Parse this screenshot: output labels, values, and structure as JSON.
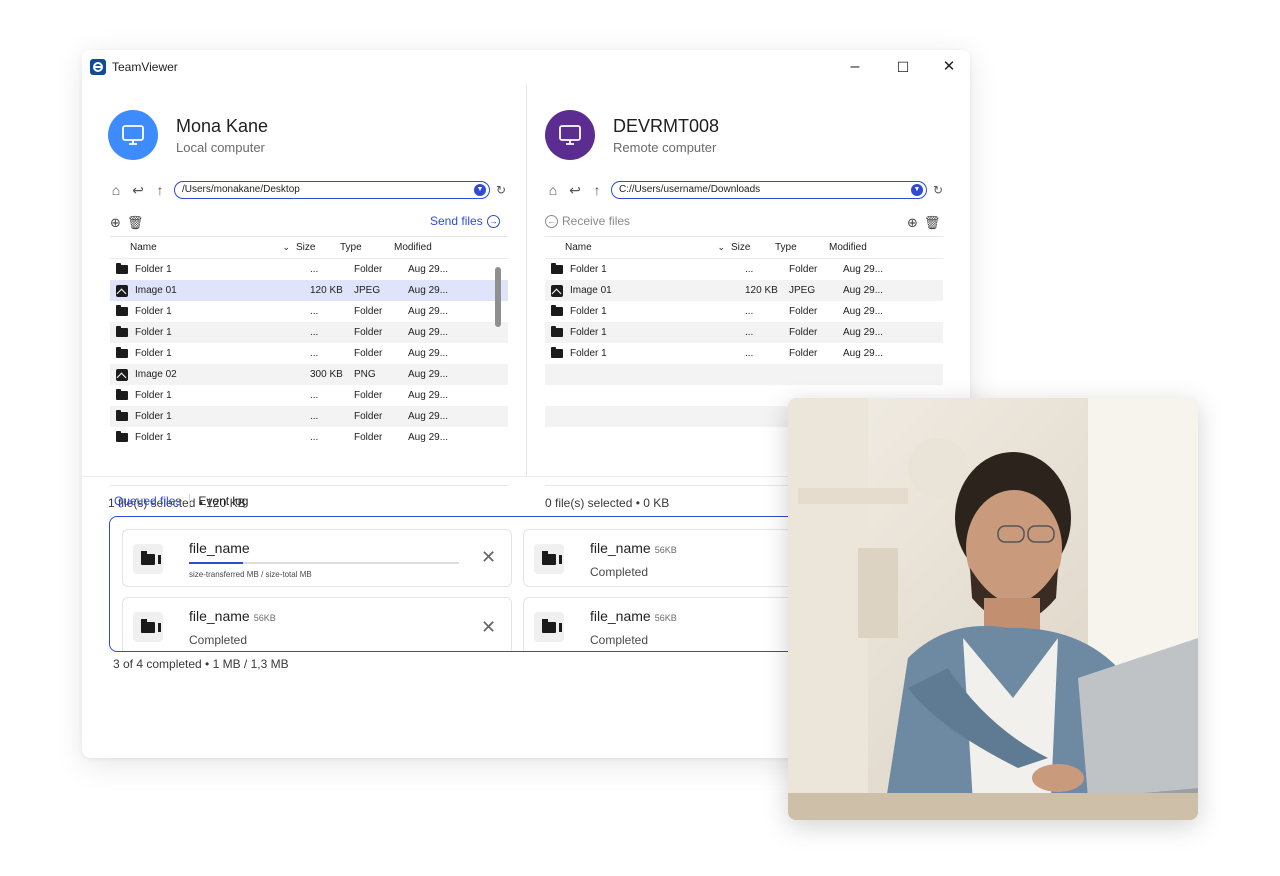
{
  "window": {
    "app_title": "TeamViewer",
    "minimize": "–",
    "maximize": "☐",
    "close": "✕"
  },
  "local": {
    "name": "Mona Kane",
    "subtitle": "Local computer",
    "avatar_color": "#3d8bfd",
    "path": "/Users/monakane/Desktop",
    "action_label": "Send files",
    "status": "1 file(s) selected  •  120 KB",
    "columns": [
      "Name",
      "Size",
      "Type",
      "Modified"
    ],
    "rows": [
      {
        "icon": "folder-icon",
        "name": "Folder 1",
        "size": "...",
        "type": "Folder",
        "modified": "Aug 29..."
      },
      {
        "icon": "image-icon",
        "name": "Image 01",
        "size": "120 KB",
        "type": "JPEG",
        "modified": "Aug 29...",
        "selected": true
      },
      {
        "icon": "folder-icon",
        "name": "Folder 1",
        "size": "...",
        "type": "Folder",
        "modified": "Aug 29..."
      },
      {
        "icon": "folder-icon",
        "name": "Folder 1",
        "size": "...",
        "type": "Folder",
        "modified": "Aug 29..."
      },
      {
        "icon": "folder-icon",
        "name": "Folder 1",
        "size": "...",
        "type": "Folder",
        "modified": "Aug 29..."
      },
      {
        "icon": "image-icon",
        "name": "Image 02",
        "size": "300 KB",
        "type": "PNG",
        "modified": "Aug 29..."
      },
      {
        "icon": "folder-icon",
        "name": "Folder 1",
        "size": "...",
        "type": "Folder",
        "modified": "Aug 29..."
      },
      {
        "icon": "folder-icon",
        "name": "Folder 1",
        "size": "...",
        "type": "Folder",
        "modified": "Aug 29..."
      },
      {
        "icon": "folder-icon",
        "name": "Folder 1",
        "size": "...",
        "type": "Folder",
        "modified": "Aug 29..."
      }
    ]
  },
  "remote": {
    "name": "DEVRMT008",
    "subtitle": "Remote computer",
    "avatar_color": "#5b2d91",
    "path": "C://Users/username/Downloads",
    "action_label": "Receive files",
    "status": "0 file(s) selected  •  0 KB",
    "columns": [
      "Name",
      "Size",
      "Type",
      "Modified"
    ],
    "rows": [
      {
        "icon": "folder-icon",
        "name": "Folder 1",
        "size": "...",
        "type": "Folder",
        "modified": "Aug 29..."
      },
      {
        "icon": "image-icon",
        "name": "Image 01",
        "size": "120 KB",
        "type": "JPEG",
        "modified": "Aug 29..."
      },
      {
        "icon": "folder-icon",
        "name": "Folder 1",
        "size": "...",
        "type": "Folder",
        "modified": "Aug 29..."
      },
      {
        "icon": "folder-icon",
        "name": "Folder 1",
        "size": "...",
        "type": "Folder",
        "modified": "Aug 29..."
      },
      {
        "icon": "folder-icon",
        "name": "Folder 1",
        "size": "...",
        "type": "Folder",
        "modified": "Aug 29..."
      }
    ]
  },
  "transfers": {
    "tabs": [
      "Queued files",
      "Event log"
    ],
    "cards": [
      {
        "name": "file_name",
        "size": "",
        "status": "size-transferred MB / size-total MB",
        "progress": 0.2,
        "closable": true
      },
      {
        "name": "file_name",
        "size": "56KB",
        "status": "Completed",
        "closable": false
      },
      {
        "name": "file_name",
        "size": "56KB",
        "status": "Completed",
        "closable": true
      },
      {
        "name": "file_name",
        "size": "56KB",
        "status": "Completed",
        "closable": false
      }
    ],
    "summary": "3 of 4 completed  •  1 MB / 1,3 MB"
  },
  "colors": {
    "accent": "#2f4bd6",
    "selected_row": "#dfe4fb"
  }
}
